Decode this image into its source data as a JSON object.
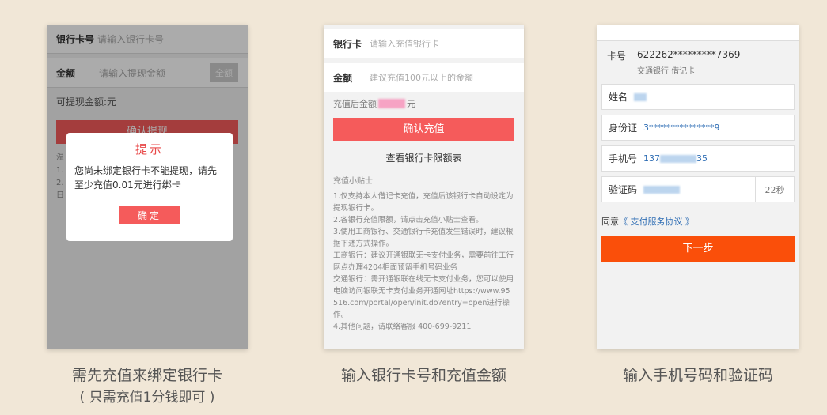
{
  "panel1": {
    "card_label": "银行卡号",
    "card_placeholder": "请输入银行卡号",
    "amount_label": "金额",
    "amount_placeholder": "请输入提现金额",
    "all_button": "全额",
    "available": "可提现金额:元",
    "confirm_button": "确认提现",
    "notes": [
      "温",
      "1.",
      "2.",
      "日"
    ],
    "dialog": {
      "title": "提示",
      "message": "您尚未绑定银行卡不能提现，请先至少充值0.01元进行绑卡",
      "ok_button": "确定"
    }
  },
  "panel2": {
    "card_label": "银行卡",
    "card_placeholder": "请输入充值银行卡",
    "amount_label": "金额",
    "amount_placeholder": "建议充值100元以上的金额",
    "after_prefix": "充值后金额",
    "after_suffix": "元",
    "confirm_button": "确认充值",
    "limit_link": "查看银行卡限额表",
    "tips_title": "充值小贴士",
    "tips": [
      "1.仅支持本人借记卡充值，充值后该银行卡自动设定为提现银行卡。",
      "2.各银行充值限额，请点击充值小贴士查看。",
      "3.使用工商银行、交通银行卡充值发生错误时，建议根据下述方式操作。",
      "工商银行：建议开通银联无卡支付业务，需要前往工行网点办理4204柜面预留手机号码业务",
      "交通银行：需开通银联在线无卡支付业务，您可以使用电脑访问银联无卡支付业务开通网址https://www.95516.com/portal/open/init.do?entry=open进行操作。",
      "4.其他问题，请联络客服 400-699-9211"
    ]
  },
  "panel3": {
    "card_label": "卡号",
    "card_number": "622262*********7369",
    "card_bank": "交通银行 借记卡",
    "name_label": "姓名",
    "id_label": "身份证",
    "id_value": "3***************9",
    "phone_label": "手机号",
    "phone_prefix": "137",
    "phone_suffix": "35",
    "code_label": "验证码",
    "countdown": "22秒",
    "agree_prefix": "同意",
    "agree_link": "《 支付服务协议 》",
    "next_button": "下一步"
  },
  "captions": {
    "c1_line1": "需先充值来绑定银行卡",
    "c1_line2": "( 只需充值1分钱即可 )",
    "c2": "输入银行卡号和充值金额",
    "c3": "输入手机号码和验证码"
  },
  "colors": {
    "background": "#f1e7d7",
    "primary_red": "#f55b5b",
    "next_orange": "#fa4f0a",
    "link_blue": "#2e6db4"
  }
}
